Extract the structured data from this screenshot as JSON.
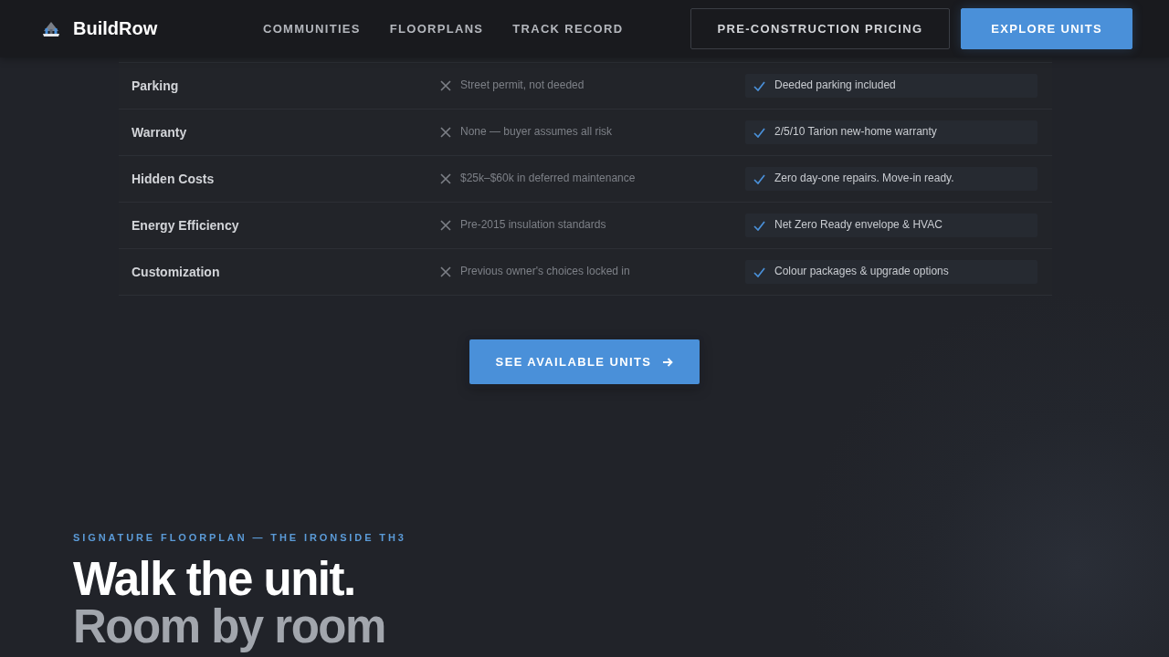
{
  "nav": {
    "brand": "BuildRow",
    "links": [
      "COMMUNITIES",
      "FLOORPLANS",
      "TRACK RECORD"
    ],
    "buttons": [
      {
        "label": "PRE-CONSTRUCTION PRICING",
        "kind": "outline"
      },
      {
        "label": "EXPLORE UNITS",
        "kind": "primary"
      }
    ]
  },
  "comparison": {
    "rows": [
      {
        "cells": [
          "Parking",
          "Street permit, not deeded",
          "Deeded parking included"
        ]
      },
      {
        "cells": [
          "Warranty",
          "None — buyer assumes all risk",
          "2/5/10 Tarion new-home warranty"
        ]
      },
      {
        "cells": [
          "Hidden Costs",
          "$25k–$60k in deferred maintenance",
          "Zero day-one repairs. Move-in ready."
        ]
      },
      {
        "cells": [
          "Energy Efficiency",
          "Pre-2015 insulation standards",
          "Net Zero Ready envelope & HVAC"
        ]
      },
      {
        "cells": [
          "Customization",
          "Previous owner's choices locked in",
          "Colour packages & upgrade options"
        ]
      }
    ]
  },
  "cta": {
    "label": "SEE AVAILABLE UNITS"
  },
  "feature": {
    "eyebrow": "SIGNATURE FLOORPLAN — THE IRONSIDE TH3",
    "title_lines": [
      "Walk the unit.",
      "Room by room"
    ]
  }
}
